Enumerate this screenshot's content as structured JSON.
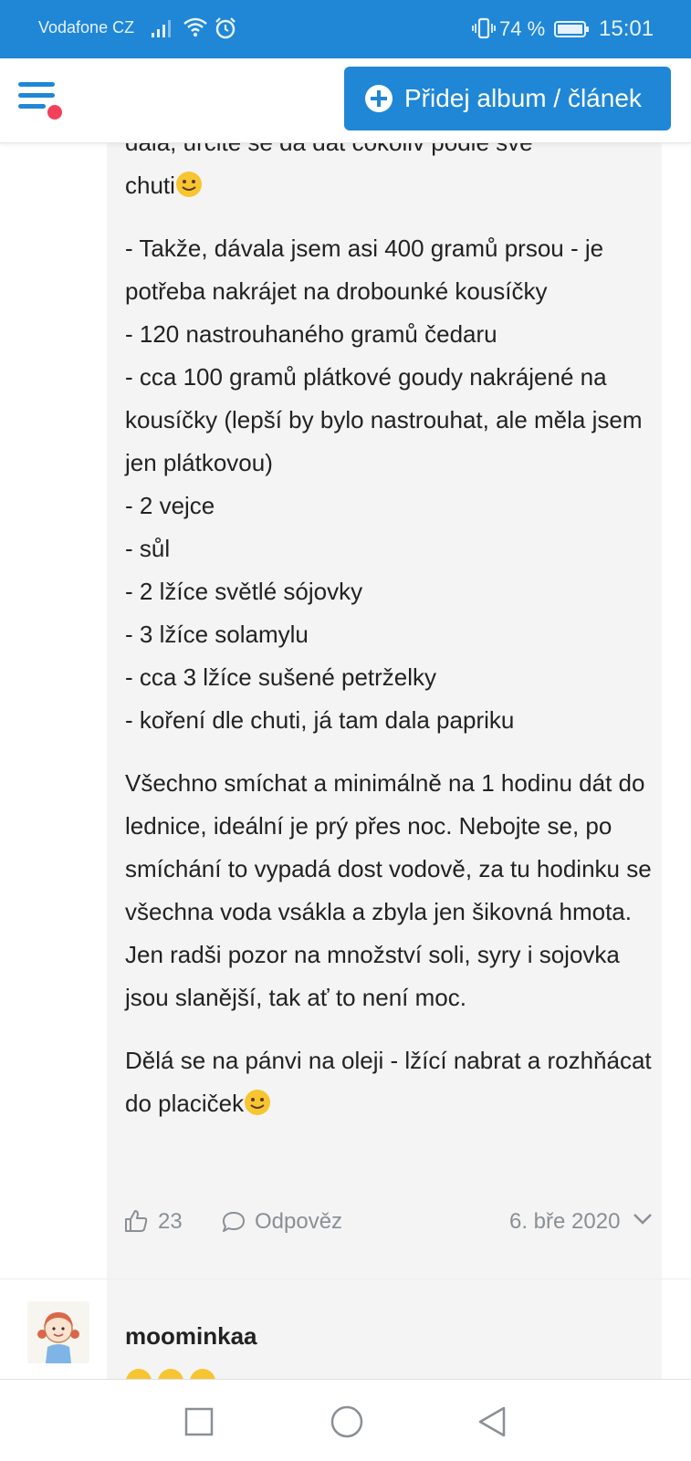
{
  "status_bar": {
    "carrier": "Vodafone CZ",
    "battery_percent": "74 %",
    "time": "15:01"
  },
  "header": {
    "add_button_label": "Přidej album / článek",
    "menu_icon": "hamburger-menu-icon",
    "notification_color": "#f2405a"
  },
  "comment": {
    "cut_first_line": "dala, určitě se dá dát cokoliv podle své",
    "intro_end": "chuti",
    "ingredients": [
      "- Takže, dávala jsem asi 400 gramů prsou - je potřeba nakrájet na drobounké kousíčky",
      "- 120 nastrouhaného gramů čedaru",
      "- cca 100 gramů plátkové goudy nakrájené na kousíčky (lepší by bylo nastrouhat, ale měla jsem jen plátkovou)",
      "- 2 vejce",
      "- sůl",
      "- 2 lžíce světlé sójovky",
      "- 3 lžíce solamylu",
      "- cca 3 lžíce sušené petrželky",
      "- koření dle chuti, já tam dala papriku"
    ],
    "paragraph2": "Všechno smíchat a minimálně na 1 hodinu dát do lednice, ideální je prý přes noc. Nebojte se, po smíchání to vypadá dost vodově, za tu hodinku se všechna voda vsákla a zbyla jen šikovná hmota. Jen radši pozor na množství soli, syry i sojovka jsou slanější, tak ať to není moc.",
    "paragraph3": "Dělá se na pánvi na oleji - lžící nabrat a rozhňácat do placiček",
    "likes": "23",
    "reply_label": "Odpověz",
    "date": "6. bře 2020"
  },
  "next_comment": {
    "username": "moominkaa"
  },
  "colors": {
    "accent": "#1f87d6",
    "bubble": "#f4f4f4",
    "meta": "#8a8f95"
  }
}
